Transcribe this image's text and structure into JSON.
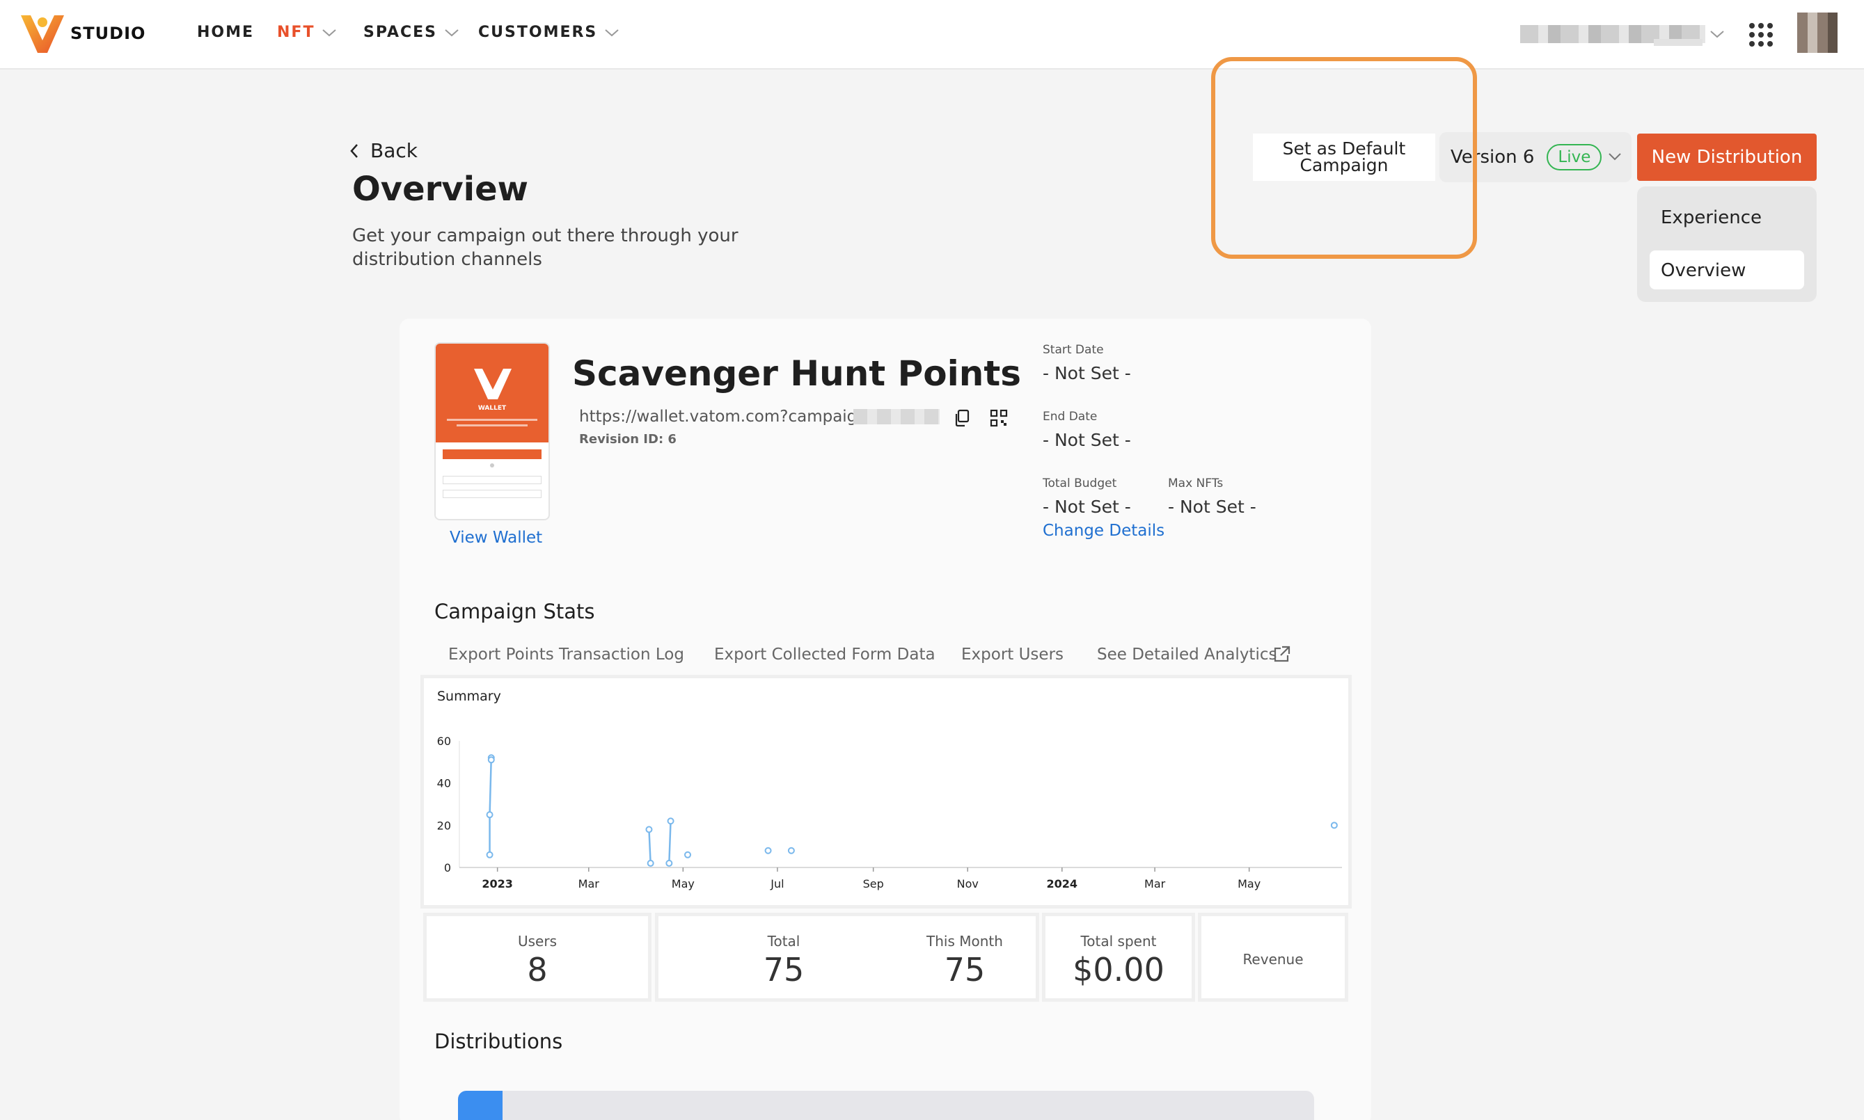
{
  "nav": {
    "logo_text": "STUDIO",
    "items": [
      {
        "label": "HOME"
      },
      {
        "label": "NFT"
      },
      {
        "label": "SPACES"
      },
      {
        "label": "CUSTOMERS"
      }
    ]
  },
  "header": {
    "back_label": "Back",
    "title": "Overview",
    "subtitle": "Get your campaign out there through your distribution channels"
  },
  "actions": {
    "default_campaign_label": "Set as Default Campaign",
    "version_label": "Version 6",
    "live_badge": "Live",
    "new_distribution_label": "New Distribution",
    "dropdown_items": [
      {
        "label": "Experience"
      },
      {
        "label": "Overview"
      }
    ]
  },
  "campaign": {
    "title": "Scavenger Hunt Points",
    "url": "https://wallet.vatom.com?campaign=",
    "revision": "Revision ID: 6",
    "view_wallet": "View Wallet",
    "wallet_thumb_text": "WALLET",
    "start_date_label": "Start Date",
    "start_date_value": "- Not Set -",
    "end_date_label": "End Date",
    "end_date_value": "- Not Set -",
    "budget_label": "Total Budget",
    "budget_value": "- Not Set -",
    "max_nfts_label": "Max NFTs",
    "max_nfts_value": "- Not Set -",
    "change_details": "Change Details"
  },
  "stats": {
    "section_title": "Campaign Stats",
    "export_links": [
      {
        "label": "Export Points Transaction Log"
      },
      {
        "label": "Export Collected Form Data"
      },
      {
        "label": "Export Users"
      },
      {
        "label": "See Detailed Analytics"
      }
    ],
    "summary_title": "Summary",
    "users_label": "Users",
    "users_value": "8",
    "total_label": "Total",
    "total_value": "75",
    "month_label": "This Month",
    "month_value": "75",
    "spent_label": "Total spent",
    "spent_value": "$0.00",
    "revenue_label": "Revenue"
  },
  "distributions": {
    "section_title": "Distributions"
  },
  "colors": {
    "accent": "#e2582e",
    "link": "#1f6fd0",
    "live": "#34b552",
    "series": "#7ab8ec",
    "highlight": "#ef9845"
  },
  "chart_data": {
    "type": "line",
    "title": "Summary",
    "xlabel": "",
    "ylabel": "",
    "ylim": [
      0,
      60
    ],
    "yticks": [
      0,
      20,
      40,
      60
    ],
    "x_ticks": [
      {
        "label": "2023",
        "date": "2023-01-01",
        "bold": true
      },
      {
        "label": "Mar",
        "date": "2023-03-01"
      },
      {
        "label": "May",
        "date": "2023-05-01"
      },
      {
        "label": "Jul",
        "date": "2023-07-01"
      },
      {
        "label": "Sep",
        "date": "2023-09-01"
      },
      {
        "label": "Nov",
        "date": "2023-11-01"
      },
      {
        "label": "2024",
        "date": "2024-01-01",
        "bold": true
      },
      {
        "label": "Mar",
        "date": "2024-03-01"
      },
      {
        "label": "May",
        "date": "2024-05-01"
      }
    ],
    "xlim": [
      "2022-12-11",
      "2024-06-30"
    ],
    "series": [
      {
        "points": [
          {
            "x": "2022-12-27",
            "y": 6
          },
          {
            "x": "2022-12-27",
            "y": 25
          },
          {
            "x": "2022-12-28",
            "y": 52
          },
          {
            "x": "2022-12-28",
            "y": 51
          },
          {
            "x": "2023-04-09",
            "y": 18
          },
          {
            "x": "2023-04-10",
            "y": 2
          },
          {
            "x": "2023-04-22",
            "y": 2
          },
          {
            "x": "2023-04-23",
            "y": 22
          },
          {
            "x": "2023-05-04",
            "y": 6
          },
          {
            "x": "2023-06-25",
            "y": 8
          },
          {
            "x": "2023-07-10",
            "y": 8
          },
          {
            "x": "2024-06-25",
            "y": 20
          }
        ]
      }
    ]
  }
}
